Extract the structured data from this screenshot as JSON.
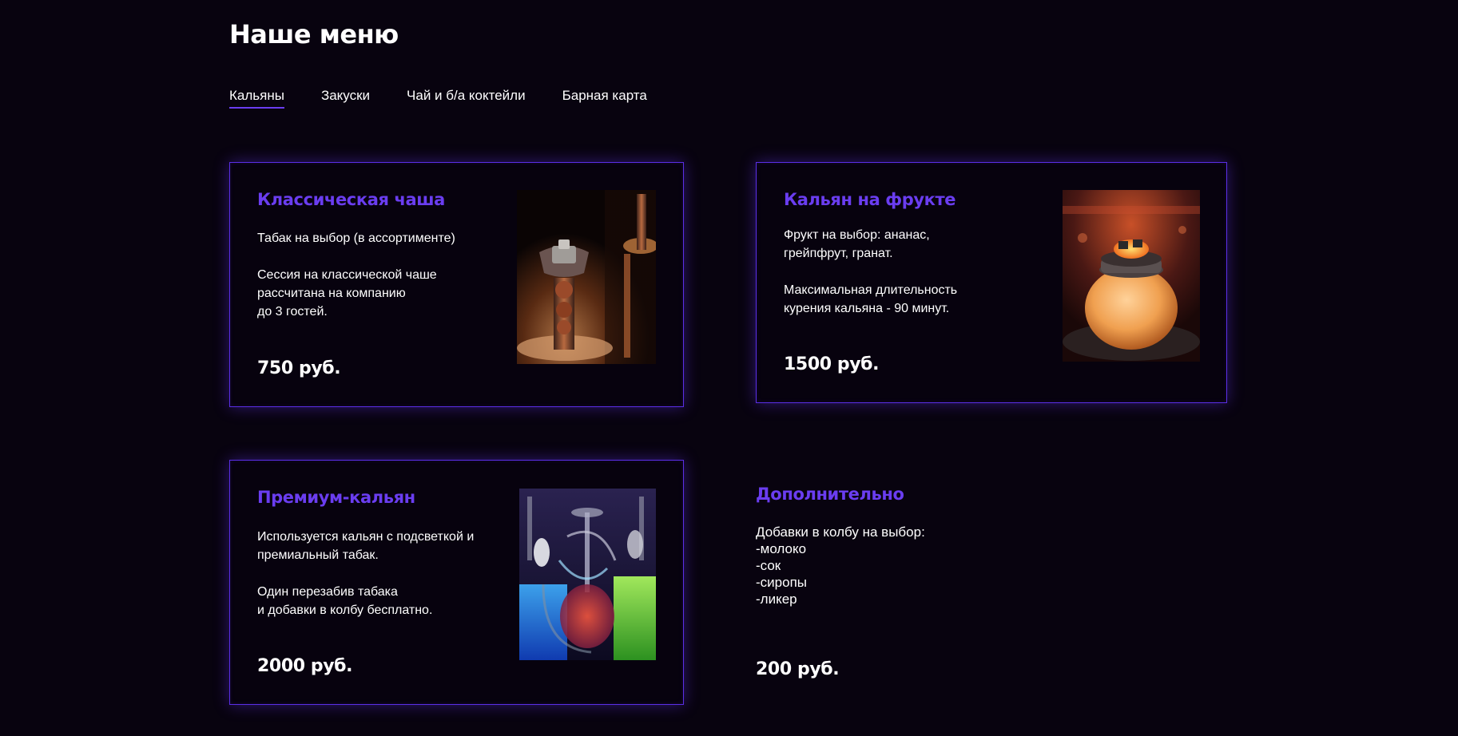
{
  "page": {
    "title": "Наше меню"
  },
  "tabs": [
    {
      "label": "Кальяны",
      "active": true
    },
    {
      "label": "Закуски",
      "active": false
    },
    {
      "label": "Чай и б/а коктейли",
      "active": false
    },
    {
      "label": "Барная карта",
      "active": false
    }
  ],
  "cards": [
    {
      "title": "Классическая чаша",
      "desc": [
        "Табак на выбор (в ассортименте)",
        "",
        "Сессия на классической чаше",
        "рассчитана на компанию",
        "до 3 гостей."
      ],
      "price": "750 руб.",
      "photo": "classic-hookah-photo"
    },
    {
      "title": "Кальян на фрукте",
      "desc": [
        "Фрукт на выбор: ананас,",
        "грейпфрут, гранат.",
        "",
        "Максимальная длительность",
        "курения кальяна - 90 минут."
      ],
      "price": "1500 руб.",
      "photo": "fruit-hookah-photo"
    },
    {
      "title": "Премиум-кальян",
      "desc": [
        "Используется кальян с подсветкой и",
        "премиальный табак.",
        "",
        "Один перезабив табака",
        "и добавки в колбу бесплатно."
      ],
      "price": "2000 руб.",
      "photo": "premium-hookah-photo"
    }
  ],
  "extra": {
    "title": "Дополнительно",
    "lines": [
      "Добавки в колбу на выбор:",
      "-молоко",
      "-сок",
      "-сиропы",
      "-ликер"
    ],
    "price": "200 руб."
  },
  "colors": {
    "background": "#08030f",
    "accent": "#6a3df0",
    "border": "#5a2ee6",
    "text": "#ffffff"
  }
}
